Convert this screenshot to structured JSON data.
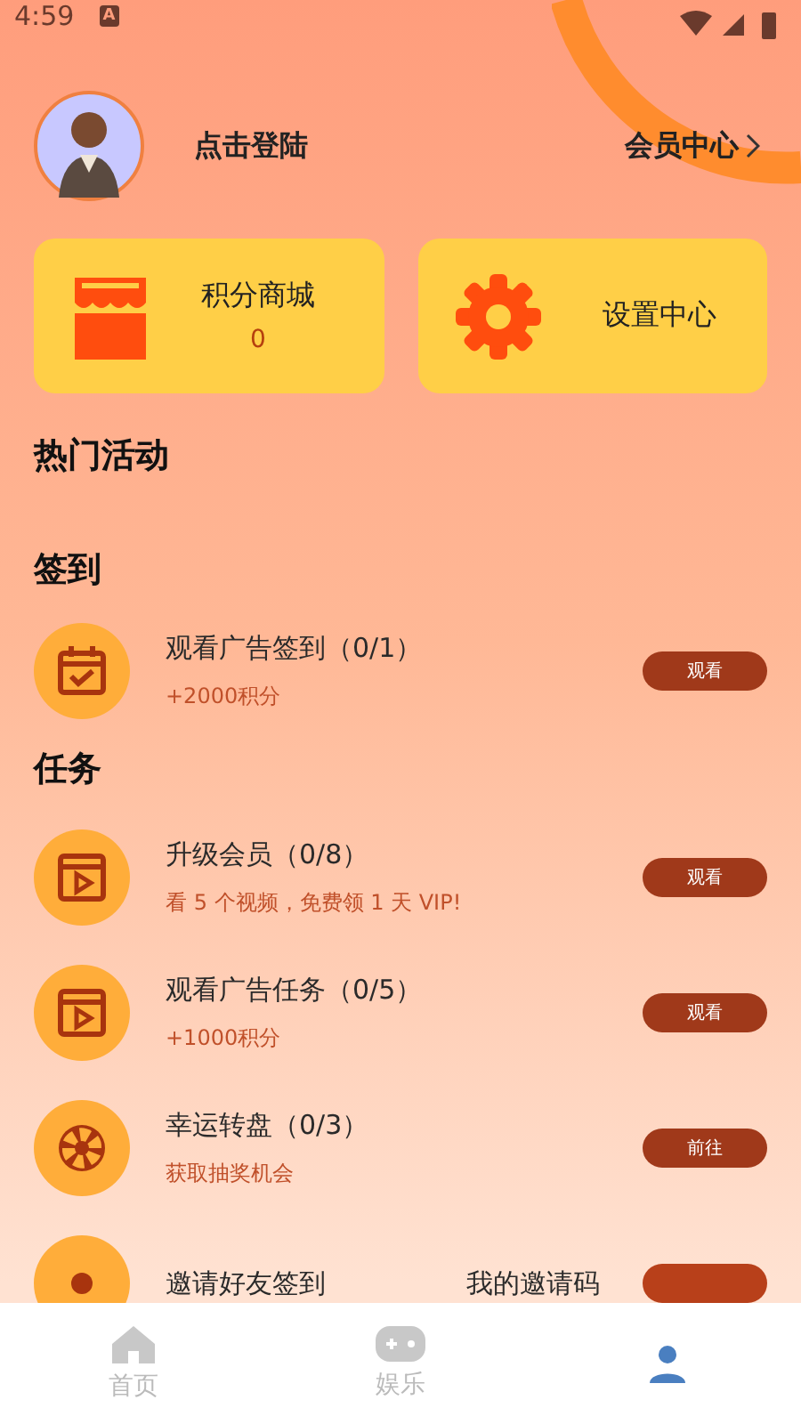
{
  "status_bar": {
    "time": "4:59",
    "notification": "A"
  },
  "profile": {
    "login_label": "点击登陆",
    "member_link": "会员中心"
  },
  "cards": [
    {
      "kind": "shop",
      "title": "积分商城",
      "value": "0"
    },
    {
      "kind": "settings",
      "title": "设置中心"
    }
  ],
  "hot_title": "热门活动",
  "sections": [
    {
      "title": "签到",
      "tasks": [
        {
          "kind": "checkin",
          "title": "观看广告签到（0/1）",
          "subtitle": "+2000积分",
          "button": "观看"
        }
      ]
    },
    {
      "title": "任务",
      "tasks": [
        {
          "kind": "video",
          "title": "升级会员（0/8）",
          "subtitle": "看 5 个视频，免费领 1 天 VIP!",
          "button": "观看"
        },
        {
          "kind": "video",
          "title": "观看广告任务（0/5）",
          "subtitle": "+1000积分",
          "button": "观看"
        },
        {
          "kind": "wheel",
          "title": "幸运转盘（0/3）",
          "subtitle": "获取抽奖机会",
          "button": "前往"
        },
        {
          "kind": "invite",
          "title": "邀请好友签到",
          "note": "我的邀请码"
        }
      ]
    }
  ],
  "nav": [
    {
      "label": "首页",
      "selected": false
    },
    {
      "label": "娱乐",
      "selected": false
    },
    {
      "selected": true
    }
  ]
}
